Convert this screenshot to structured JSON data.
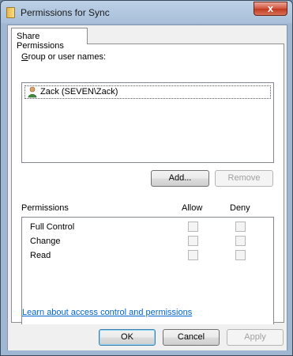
{
  "window": {
    "title": "Permissions for Sync",
    "close_label": "x",
    "folder_icon": "folder-icon"
  },
  "tabs": [
    {
      "label": "Share Permissions",
      "selected": true
    }
  ],
  "group": {
    "label": "Group or user names:",
    "items": [
      {
        "name": "Zack (SEVEN\\Zack)",
        "icon": "user-icon"
      }
    ]
  },
  "buttons": {
    "add": "Add...",
    "remove": "Remove",
    "ok": "OK",
    "cancel": "Cancel",
    "apply": "Apply"
  },
  "permissions": {
    "header": "Permissions",
    "allow_header": "Allow",
    "deny_header": "Deny",
    "rows": [
      {
        "name": "Full Control",
        "allow": false,
        "deny": false
      },
      {
        "name": "Change",
        "allow": false,
        "deny": false
      },
      {
        "name": "Read",
        "allow": false,
        "deny": false
      }
    ]
  },
  "help_link": "Learn about access control and permissions",
  "colors": {
    "link": "#0066cc",
    "default_button_border": "#3c7fb1"
  }
}
